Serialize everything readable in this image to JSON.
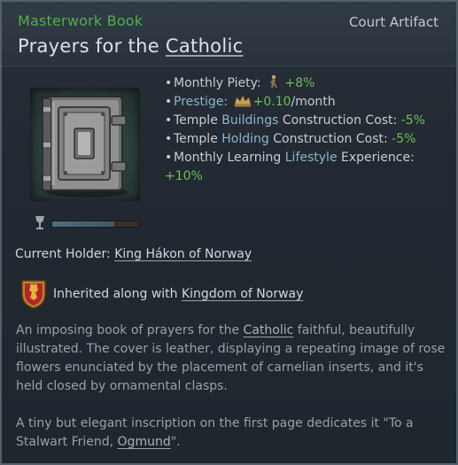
{
  "header": {
    "subtitle": "Masterwork Book",
    "type_label": "Court Artifact",
    "title_prefix": "Prayers for the",
    "title_faith": "Catholic"
  },
  "artifact": {
    "icon": "book-icon",
    "condition_icon": "goblet-icon",
    "condition_fraction": 0.72
  },
  "modifiers": [
    {
      "prefix": "Monthly Piety:",
      "icon": "piety-icon",
      "value": "+8%"
    },
    {
      "prefix": "Prestige:",
      "icon": "crown-icon",
      "value": "+0.10",
      "suffix": "/month"
    },
    {
      "text1": "Temple",
      "link": "Buildings",
      "text2": "Construction Cost:",
      "value": "-5%"
    },
    {
      "text1": "Temple",
      "link": "Holding",
      "text2": "Construction Cost:",
      "value": "-5%"
    },
    {
      "text1": "Monthly Learning",
      "link": "Lifestyle",
      "text2": "Experience:",
      "value": "+10%"
    }
  ],
  "holder": {
    "label": "Current Holder:",
    "name": "King Hákon of Norway"
  },
  "inherit": {
    "icon": "coat-of-arms-icon",
    "label": "Inherited along with",
    "title": "Kingdom of Norway"
  },
  "description": {
    "p1_a": "An imposing book of prayers for the",
    "p1_link": "Catholic",
    "p1_b": "faithful, beautifully illustrated. The cover is leather, displaying a repeating image of rose flowers enunciated by the placement of carnelian inserts, and it's held closed by ornamental clasps.",
    "p2_a": "A tiny but elegant inscription on the first page dedicates it \"To a Stalwart Friend,",
    "p2_link": "Ogmund",
    "p2_b": "\"."
  },
  "colors": {
    "subtitle_green": "#4fb04a",
    "positive_green": "#6fbf5a",
    "link_blue": "#8cb4c9",
    "background": "#222932"
  }
}
